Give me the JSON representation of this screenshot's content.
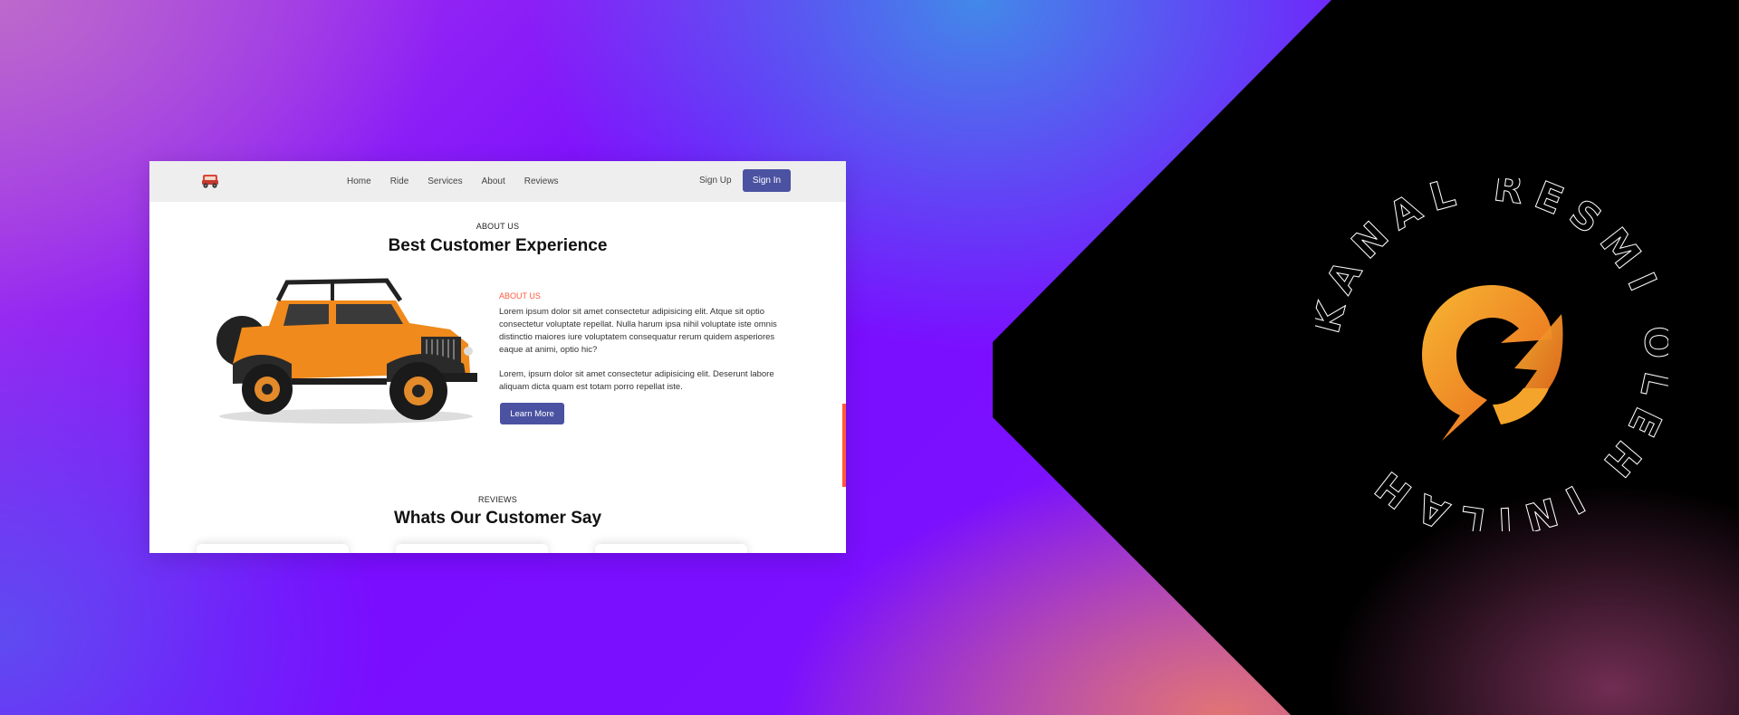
{
  "nav": {
    "logo_icon": "car-icon",
    "items": [
      {
        "label": "Home"
      },
      {
        "label": "Ride"
      },
      {
        "label": "Services"
      },
      {
        "label": "About"
      },
      {
        "label": "Reviews"
      }
    ],
    "signup_label": "Sign Up",
    "signin_label": "Sign In"
  },
  "about": {
    "eyebrow": "ABOUT US",
    "title": "Best Customer Experience",
    "tag": "ABOUT US",
    "paragraph1": "Lorem ipsum dolor sit amet consectetur adipisicing elit. Atque sit optio consectetur voluptate repellat. Nulla harum ipsa nihil voluptate iste omnis distinctio maiores iure voluptatem consequatur rerum quidem asperiores eaque at animi, optio hic?",
    "paragraph2": "Lorem, ipsum dolor sit amet consectetur adipisicing elit. Deserunt labore aliquam dicta quam est totam porro repellat iste.",
    "button_label": "Learn More",
    "image": "jeep-image"
  },
  "reviews": {
    "eyebrow": "REVIEWS",
    "title": "Whats Our Customer Say"
  },
  "emblem": {
    "ring_text": "KANAL RESMI OLEH INILAH",
    "icon": "lightning-logo-icon"
  },
  "colors": {
    "accent": "#4b52a1",
    "highlight": "#ff5a3c",
    "jeep_orange": "#f08a1c"
  }
}
